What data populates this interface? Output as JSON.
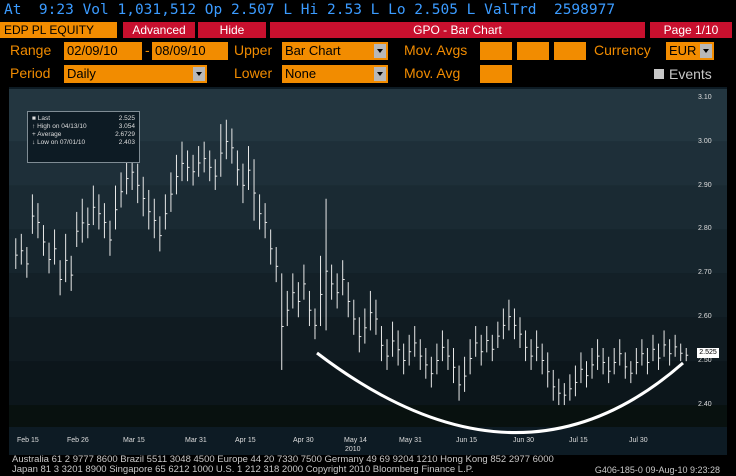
{
  "ticker_line": "At  9:23 Vol 1,031,512 Op 2.507 L Hi 2.53 L Lo 2.505 L ValTrd  2598977",
  "toolbar": {
    "security": "EDP PL EQUITY",
    "advanced": "Advanced",
    "hide": "Hide",
    "title": "GPO - Bar Chart",
    "page": "Page 1/10"
  },
  "form": {
    "range_label": "Range",
    "range_start": "02/09/10",
    "range_sep": "-",
    "range_end": "08/09/10",
    "upper_label": "Upper",
    "upper_value": "Bar Chart",
    "mov_avgs_label": "Mov. Avgs",
    "currency_label": "Currency",
    "currency_value": "EUR",
    "period_label": "Period",
    "period_value": "Daily",
    "lower_label": "Lower",
    "lower_value": "None",
    "mov_avg_label": "Mov. Avg",
    "events_label": "Events"
  },
  "legend": {
    "last_label": "Last",
    "last_value": "2.525",
    "high_label": "High on 04/13/10",
    "high_value": "3.054",
    "avg_label": "Average",
    "avg_value": "2.6729",
    "low_label": "Low on 07/01/10",
    "low_value": "2.403"
  },
  "chart_data": {
    "type": "bar",
    "subtype": "ohlc",
    "ylim": [
      2.35,
      3.12
    ],
    "yticks": [
      "3.10",
      "3.00",
      "2.90",
      "2.80",
      "2.70",
      "2.60",
      "2.50",
      "2.40"
    ],
    "xticks": [
      "Feb 15",
      "Feb 26",
      "Mar 15",
      "Mar 31",
      "Apr 15",
      "Apr 30",
      "May 14",
      "May 31",
      "Jun 15",
      "Jun 30",
      "Jul 15",
      "Jul 30"
    ],
    "year_label": "2010",
    "last_price_label": "2.525",
    "bars": [
      [
        2.78,
        2.71
      ],
      [
        2.79,
        2.72
      ],
      [
        2.76,
        2.69
      ],
      [
        2.88,
        2.79
      ],
      [
        2.86,
        2.78
      ],
      [
        2.81,
        2.74
      ],
      [
        2.77,
        2.7
      ],
      [
        2.8,
        2.72
      ],
      [
        2.73,
        2.65
      ],
      [
        2.79,
        2.68
      ],
      [
        2.74,
        2.66
      ],
      [
        2.84,
        2.76
      ],
      [
        2.87,
        2.77
      ],
      [
        2.85,
        2.78
      ],
      [
        2.9,
        2.81
      ],
      [
        2.88,
        2.8
      ],
      [
        2.86,
        2.78
      ],
      [
        2.82,
        2.74
      ],
      [
        2.9,
        2.8
      ],
      [
        2.93,
        2.85
      ],
      [
        2.96,
        2.88
      ],
      [
        2.98,
        2.89
      ],
      [
        2.95,
        2.86
      ],
      [
        2.92,
        2.83
      ],
      [
        2.89,
        2.8
      ],
      [
        2.87,
        2.78
      ],
      [
        2.83,
        2.75
      ],
      [
        2.88,
        2.8
      ],
      [
        2.93,
        2.84
      ],
      [
        2.97,
        2.88
      ],
      [
        3.0,
        2.91
      ],
      [
        2.98,
        2.91
      ],
      [
        2.97,
        2.9
      ],
      [
        2.99,
        2.92
      ],
      [
        3.0,
        2.93
      ],
      [
        2.98,
        2.91
      ],
      [
        2.96,
        2.89
      ],
      [
        3.04,
        2.92
      ],
      [
        3.05,
        2.96
      ],
      [
        3.03,
        2.95
      ],
      [
        2.98,
        2.9
      ],
      [
        2.95,
        2.86
      ],
      [
        2.99,
        2.89
      ],
      [
        2.96,
        2.82
      ],
      [
        2.88,
        2.8
      ],
      [
        2.86,
        2.78
      ],
      [
        2.8,
        2.72
      ],
      [
        2.76,
        2.68
      ],
      [
        2.7,
        2.48
      ],
      [
        2.66,
        2.58
      ],
      [
        2.7,
        2.62
      ],
      [
        2.68,
        2.6
      ],
      [
        2.72,
        2.64
      ],
      [
        2.66,
        2.58
      ],
      [
        2.62,
        2.55
      ],
      [
        2.74,
        2.58
      ],
      [
        2.87,
        2.57
      ],
      [
        2.72,
        2.64
      ],
      [
        2.7,
        2.62
      ],
      [
        2.73,
        2.65
      ],
      [
        2.68,
        2.6
      ],
      [
        2.64,
        2.56
      ],
      [
        2.6,
        2.52
      ],
      [
        2.62,
        2.54
      ],
      [
        2.66,
        2.57
      ],
      [
        2.64,
        2.56
      ],
      [
        2.58,
        2.5
      ],
      [
        2.55,
        2.48
      ],
      [
        2.59,
        2.51
      ],
      [
        2.57,
        2.49
      ],
      [
        2.54,
        2.47
      ],
      [
        2.56,
        2.49
      ],
      [
        2.58,
        2.51
      ],
      [
        2.55,
        2.48
      ],
      [
        2.53,
        2.46
      ],
      [
        2.51,
        2.44
      ],
      [
        2.54,
        2.47
      ],
      [
        2.57,
        2.5
      ],
      [
        2.55,
        2.48
      ],
      [
        2.53,
        2.45
      ],
      [
        2.49,
        2.41
      ],
      [
        2.51,
        2.43
      ],
      [
        2.55,
        2.47
      ],
      [
        2.58,
        2.51
      ],
      [
        2.56,
        2.49
      ],
      [
        2.58,
        2.52
      ],
      [
        2.56,
        2.5
      ],
      [
        2.59,
        2.53
      ],
      [
        2.62,
        2.55
      ],
      [
        2.64,
        2.57
      ],
      [
        2.62,
        2.55
      ],
      [
        2.6,
        2.53
      ],
      [
        2.57,
        2.5
      ],
      [
        2.55,
        2.48
      ],
      [
        2.57,
        2.5
      ],
      [
        2.54,
        2.47
      ],
      [
        2.52,
        2.44
      ],
      [
        2.48,
        2.41
      ],
      [
        2.46,
        2.4
      ],
      [
        2.45,
        2.4
      ],
      [
        2.47,
        2.41
      ],
      [
        2.49,
        2.42
      ],
      [
        2.52,
        2.45
      ],
      [
        2.5,
        2.44
      ],
      [
        2.53,
        2.46
      ],
      [
        2.55,
        2.48
      ],
      [
        2.53,
        2.47
      ],
      [
        2.51,
        2.45
      ],
      [
        2.53,
        2.47
      ],
      [
        2.55,
        2.49
      ],
      [
        2.52,
        2.46
      ],
      [
        2.5,
        2.45
      ],
      [
        2.53,
        2.47
      ],
      [
        2.55,
        2.49
      ],
      [
        2.53,
        2.47
      ],
      [
        2.56,
        2.5
      ],
      [
        2.54,
        2.48
      ],
      [
        2.57,
        2.51
      ],
      [
        2.55,
        2.49
      ],
      [
        2.56,
        2.51
      ],
      [
        2.54,
        2.5
      ],
      [
        2.53,
        2.5
      ]
    ]
  },
  "footer": {
    "line1": "Australia 61 2 9777 8600 Brazil 5511 3048 4500 Europe 44 20 7330 7500 Germany 49 69 9204 1210 Hong Kong 852 2977 6000",
    "line2": "Japan 81 3 3201 8900        Singapore 65 6212 1000     U.S. 1 212 318 2000       Copyright 2010 Bloomberg Finance L.P.",
    "code": "G406-185-0 09-Aug-10  9:23:28"
  },
  "colors": {
    "ticker": "#3b9bff",
    "bloomberg_orange": "#f28c00",
    "bloomberg_red": "#c8102e",
    "chart_bg": "#0d1b24"
  }
}
